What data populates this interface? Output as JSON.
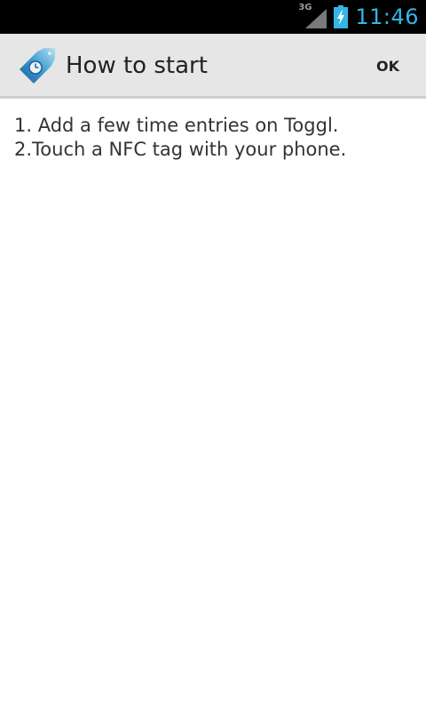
{
  "status_bar": {
    "network_type": "3G",
    "clock": "11:46",
    "icons": [
      "network-signal-icon",
      "battery-charging-icon"
    ],
    "accent_color": "#33b5e5"
  },
  "action_bar": {
    "title": "How to start",
    "ok_label": "OK",
    "app_icon": "toggl-nfc-tag-icon"
  },
  "instructions": [
    "1. Add a few time entries on Toggl.",
    "2.Touch a NFC tag with your phone."
  ]
}
